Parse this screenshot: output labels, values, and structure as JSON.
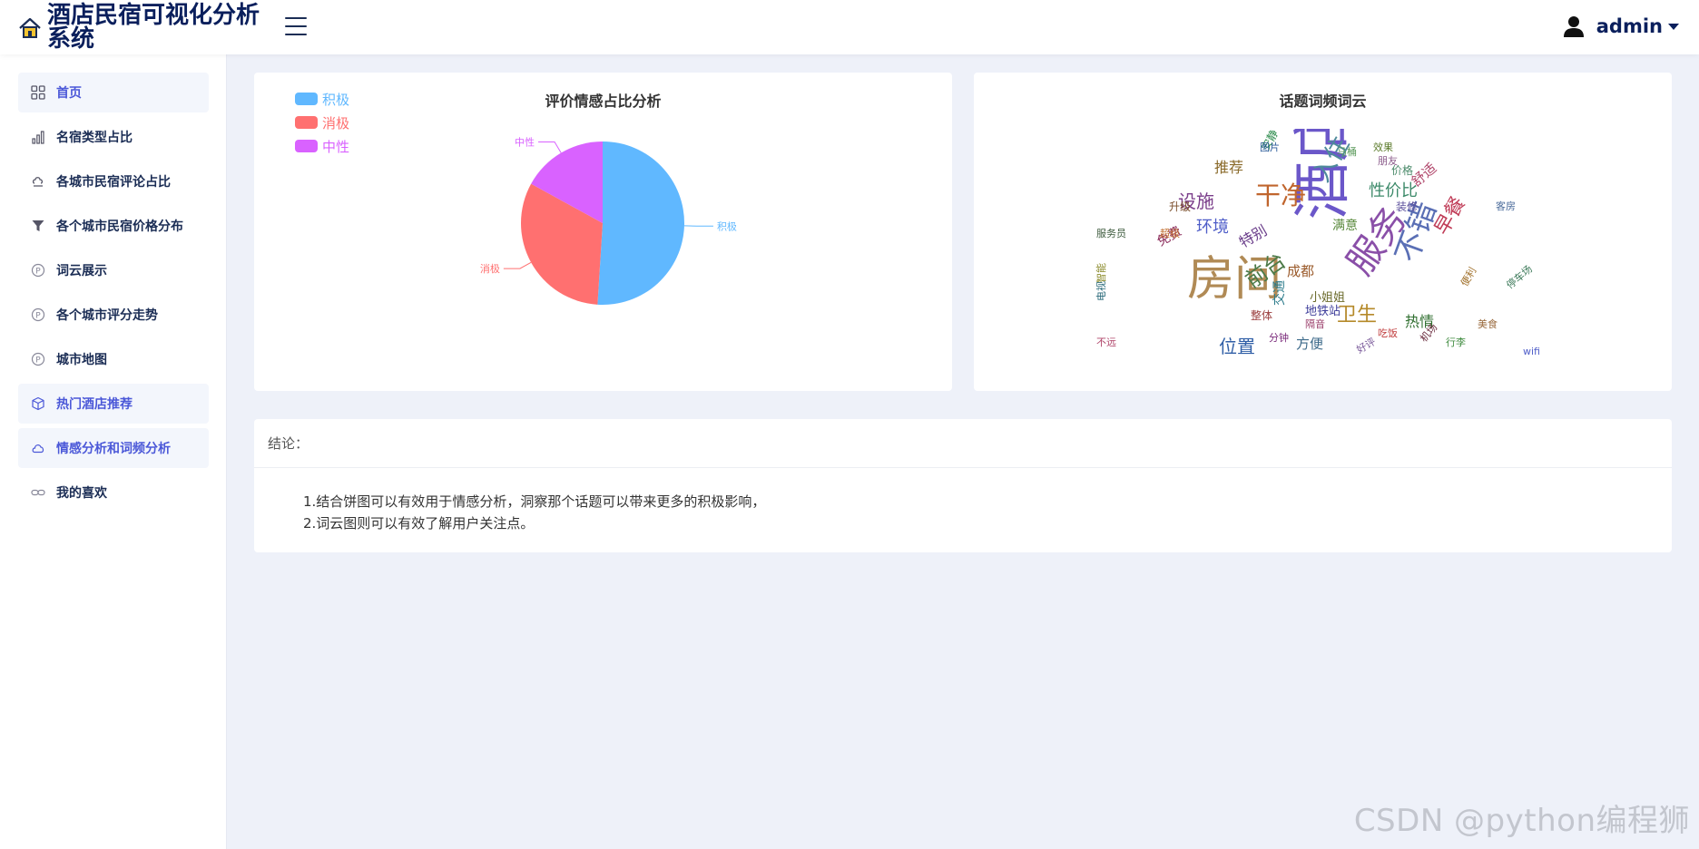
{
  "header": {
    "app_title": "酒店民宿可视化分析系统",
    "user_name": "admin"
  },
  "sidebar": {
    "items": [
      {
        "label": "首页",
        "icon": "grid-icon"
      },
      {
        "label": "名宿类型占比",
        "icon": "bar-chart-icon"
      },
      {
        "label": "各城市民宿评论占比",
        "icon": "cloud-icon"
      },
      {
        "label": "各个城市民宿价格分布",
        "icon": "filter-icon"
      },
      {
        "label": "词云展示",
        "icon": "p-circle-icon"
      },
      {
        "label": "各个城市评分走势",
        "icon": "p-circle-icon"
      },
      {
        "label": "城市地图",
        "icon": "p-circle-icon"
      },
      {
        "label": "热门酒店推荐",
        "icon": "box-icon"
      },
      {
        "label": "情感分析和词频分析",
        "icon": "cloud-outline-icon"
      },
      {
        "label": "我的喜欢",
        "icon": "link-icon"
      }
    ]
  },
  "sentiment_card": {
    "title": "评价情感占比分析",
    "legend": [
      {
        "label": "积极",
        "color": "#60b8ff"
      },
      {
        "label": "消极",
        "color": "#ff7070"
      },
      {
        "label": "中性",
        "color": "#d962ff"
      }
    ]
  },
  "chart_data": {
    "type": "pie",
    "title": "评价情感占比分析",
    "slices": [
      {
        "label": "积极",
        "value": 51,
        "color": "#60b8ff"
      },
      {
        "label": "消极",
        "value": 32,
        "color": "#ff7070"
      },
      {
        "label": "中性",
        "value": 17,
        "color": "#d962ff"
      }
    ],
    "legend_position": "top-left"
  },
  "wordcloud_card": {
    "title": "话题词频词云",
    "words": [
      {
        "text": "酒店",
        "size": 64,
        "color": "#6b57c9"
      },
      {
        "text": "房间",
        "size": 52,
        "color": "#b08a55"
      },
      {
        "text": "服务",
        "size": 40,
        "color": "#8a4fa8"
      },
      {
        "text": "不错",
        "size": 34,
        "color": "#5a6fb5"
      },
      {
        "text": "干净",
        "size": 28,
        "color": "#c0652d"
      },
      {
        "text": "入住",
        "size": 26,
        "color": "#4d8a9a"
      },
      {
        "text": "前台",
        "size": 24,
        "color": "#4c7a48"
      },
      {
        "text": "早餐",
        "size": 22,
        "color": "#c03c57"
      },
      {
        "text": "卫生",
        "size": 22,
        "color": "#b58a2a"
      },
      {
        "text": "位置",
        "size": 20,
        "color": "#2f5ea6"
      },
      {
        "text": "设施",
        "size": 20,
        "color": "#7a3d8a"
      },
      {
        "text": "性价比",
        "size": 18,
        "color": "#3d8a6a"
      },
      {
        "text": "环境",
        "size": 18,
        "color": "#4e5dc8"
      },
      {
        "text": "热情",
        "size": 16,
        "color": "#2f6e2f"
      },
      {
        "text": "推荐",
        "size": 16,
        "color": "#8a6a2a"
      },
      {
        "text": "特别",
        "size": 16,
        "color": "#6a3d8a"
      },
      {
        "text": "舒适",
        "size": 15,
        "color": "#b0456a"
      },
      {
        "text": "方便",
        "size": 15,
        "color": "#3d6a8a"
      },
      {
        "text": "成都",
        "size": 15,
        "color": "#9a5a2a"
      },
      {
        "text": "满意",
        "size": 14,
        "color": "#5a8a3d"
      },
      {
        "text": "交通",
        "size": 14,
        "color": "#2a7a8a"
      },
      {
        "text": "免费",
        "size": 14,
        "color": "#8a2a5a"
      },
      {
        "text": "小姐姐",
        "size": 13,
        "color": "#6a6a2a"
      },
      {
        "text": "地铁站",
        "size": 13,
        "color": "#3d3d9a"
      },
      {
        "text": "升级",
        "size": 12,
        "color": "#7a4d2a"
      },
      {
        "text": "价格",
        "size": 12,
        "color": "#4a8a6a"
      },
      {
        "text": "整体",
        "size": 12,
        "color": "#9a3d3d"
      },
      {
        "text": "装修",
        "size": 12,
        "color": "#5a4d9a"
      },
      {
        "text": "安静",
        "size": 12,
        "color": "#2a8a4a"
      },
      {
        "text": "朋友",
        "size": 11,
        "color": "#8a5a8a"
      },
      {
        "text": "超级",
        "size": 11,
        "color": "#c06a2a"
      },
      {
        "text": "效果",
        "size": 11,
        "color": "#5a7a2a"
      },
      {
        "text": "图片",
        "size": 11,
        "color": "#2a5a9a"
      },
      {
        "text": "分钟",
        "size": 11,
        "color": "#7a2a7a"
      },
      {
        "text": "停车场",
        "size": 11,
        "color": "#3d7a5a"
      },
      {
        "text": "wifi",
        "size": 11,
        "color": "#4e5dc8"
      },
      {
        "text": "美食",
        "size": 11,
        "color": "#9a6a3d"
      },
      {
        "text": "好玩",
        "size": 11,
        "color": "#5a3d7a"
      },
      {
        "text": "不远",
        "size": 11,
        "color": "#b0456a"
      },
      {
        "text": "服务员",
        "size": 11,
        "color": "#3d5a3d"
      },
      {
        "text": "智能",
        "size": 11,
        "color": "#8a8a2a"
      },
      {
        "text": "吃饭",
        "size": 11,
        "color": "#c03c3c"
      },
      {
        "text": "电视",
        "size": 11,
        "color": "#2a6a7a"
      },
      {
        "text": "机场",
        "size": 11,
        "color": "#6a2a3d"
      },
      {
        "text": "行李",
        "size": 11,
        "color": "#3d8a3d"
      },
      {
        "text": "好评",
        "size": 11,
        "color": "#7a5a9a"
      },
      {
        "text": "隔音",
        "size": 11,
        "color": "#9a3d6a"
      },
      {
        "text": "客房",
        "size": 11,
        "color": "#4a6a9a"
      },
      {
        "text": "便利",
        "size": 11,
        "color": "#a0702a"
      },
      {
        "text": "马桶",
        "size": 11,
        "color": "#5a9a5a"
      }
    ]
  },
  "conclusion": {
    "header": "结论：",
    "lines": [
      "1.结合饼图可以有效用于情感分析，洞察那个话题可以带来更多的积极影响，",
      "2.词云图则可以有效了解用户关注点。"
    ]
  },
  "watermark": "CSDN @python编程狮"
}
